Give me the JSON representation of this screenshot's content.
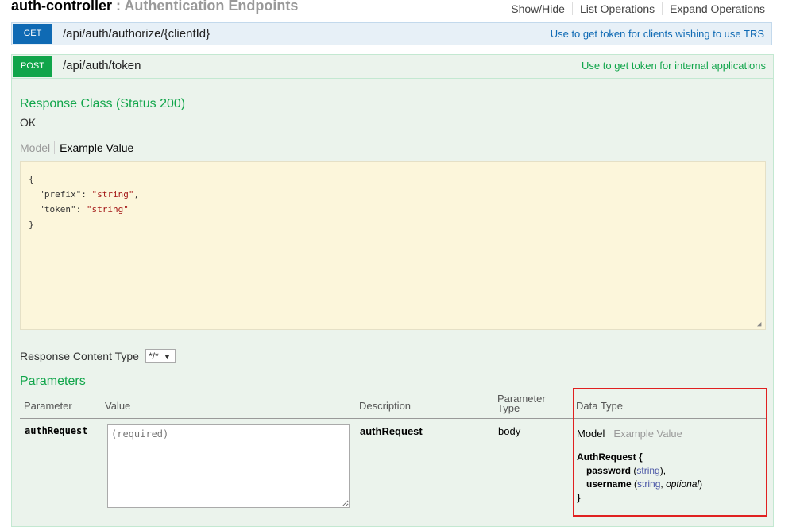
{
  "controller": {
    "name": "auth-controller",
    "separator": " : ",
    "description": "Authentication Endpoints"
  },
  "operations_links": [
    "Show/Hide",
    "List Operations",
    "Expand Operations"
  ],
  "get_op": {
    "method": "GET",
    "path": "/api/auth/authorize/{clientId}",
    "summary": "Use to get token for clients wishing to use TRS"
  },
  "post_op": {
    "method": "POST",
    "path": "/api/auth/token",
    "summary": "Use to get token for internal applications",
    "response_class_title": "Response Class (Status 200)",
    "response_class_value": "OK",
    "response_tabs": {
      "model": "Model",
      "example": "Example Value"
    },
    "example_lines": {
      "open": "{",
      "prefix_key": "\"prefix\"",
      "prefix_val": "\"string\"",
      "token_key": "\"token\"",
      "token_val": "\"string\"",
      "close": "}"
    },
    "response_content_type_label": "Response Content Type",
    "response_content_type_value": "*/*",
    "parameters_title": "Parameters",
    "param_headers": {
      "parameter": "Parameter",
      "value": "Value",
      "description": "Description",
      "parameter_type_1": "Parameter",
      "parameter_type_2": "Type",
      "data_type": "Data Type"
    },
    "param_row": {
      "name": "authRequest",
      "value_placeholder": "(required)",
      "description": "authRequest",
      "parameter_type": "body"
    },
    "data_type_tabs": {
      "model": "Model",
      "example": "Example Value"
    },
    "model": {
      "open": "AuthRequest {",
      "field1_name": "password",
      "field1_type": "string",
      "field2_name": "username",
      "field2_type": "string",
      "field2_opt": "optional",
      "close": "}"
    }
  },
  "colors": {
    "get": "#0f6ab4",
    "post": "#10a54a",
    "highlight": "#e02020",
    "example_bg": "#fcf6db"
  }
}
